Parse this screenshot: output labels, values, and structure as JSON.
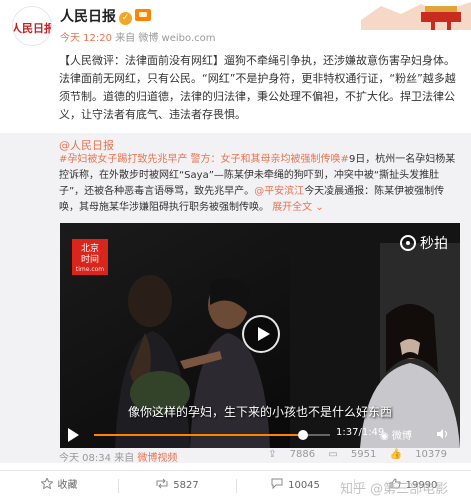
{
  "post": {
    "author": "人民日报",
    "avatar_label": "人民日报",
    "time": "今天 12:20",
    "via": "来自 微博 weibo.com",
    "text_prefix": "【人民微评：法律面前没有网红】",
    "text_body": "遛狗不牵绳引争执，还涉嫌故意伤害孕妇身体。法律面前无网红，只有公民。“网红”不是护身符，更非特权通行证，“粉丝”越多越须节制。道德的归道德，法律的归法律，秉公处理不偏袒，不扩大化。捍卫法律公义，让守法者有底气、违法者存畏惧。"
  },
  "repost": {
    "author": "@人民日报",
    "text_hashtag": "#孕妇被女子踢打致先兆早产 警方：女子和其母亲均被强制传唤#",
    "text_body_1": "9日，杭州一名孕妇杨某控诉称，在外散步时被网红“Saya”—陈某伊未牵绳的狗吓到，冲突中被“撕扯头发推肚子”，还被各种恶毒言语辱骂，致先兆早产。",
    "text_mention": "@平安滨江",
    "text_body_2": "今天凌晨通报：陈某伊被强制传唤，其母施某华涉嫌阻碍执行职务被强制传唤。",
    "expand_label": "展开全文",
    "expand_icon": "chevron-down",
    "footer_time": "今天 08:34",
    "footer_via": "来自",
    "footer_source": "微博视频",
    "stats": {
      "reposts": "7886",
      "comments": "5951",
      "likes": "10379"
    }
  },
  "video": {
    "channel_logo_line1": "北京",
    "channel_logo_line2": "时间",
    "channel_logo_small": "time.com",
    "brand": "秒拍",
    "subtitle": "像你这样的孕妇，生下来的小孩也不是什么好东西",
    "time": "1:37/1:49",
    "progress": 0.885,
    "watermark": "微博"
  },
  "actions": {
    "favorite": "收藏",
    "repost": "5827",
    "comment": "10045",
    "like": "19990"
  },
  "overlay_watermark": "知乎 @第三部电影",
  "colors": {
    "accent": "#eb7350",
    "repost_bg": "#f2f2f5",
    "progress": "#ff8200",
    "verified": "#f5a623"
  }
}
